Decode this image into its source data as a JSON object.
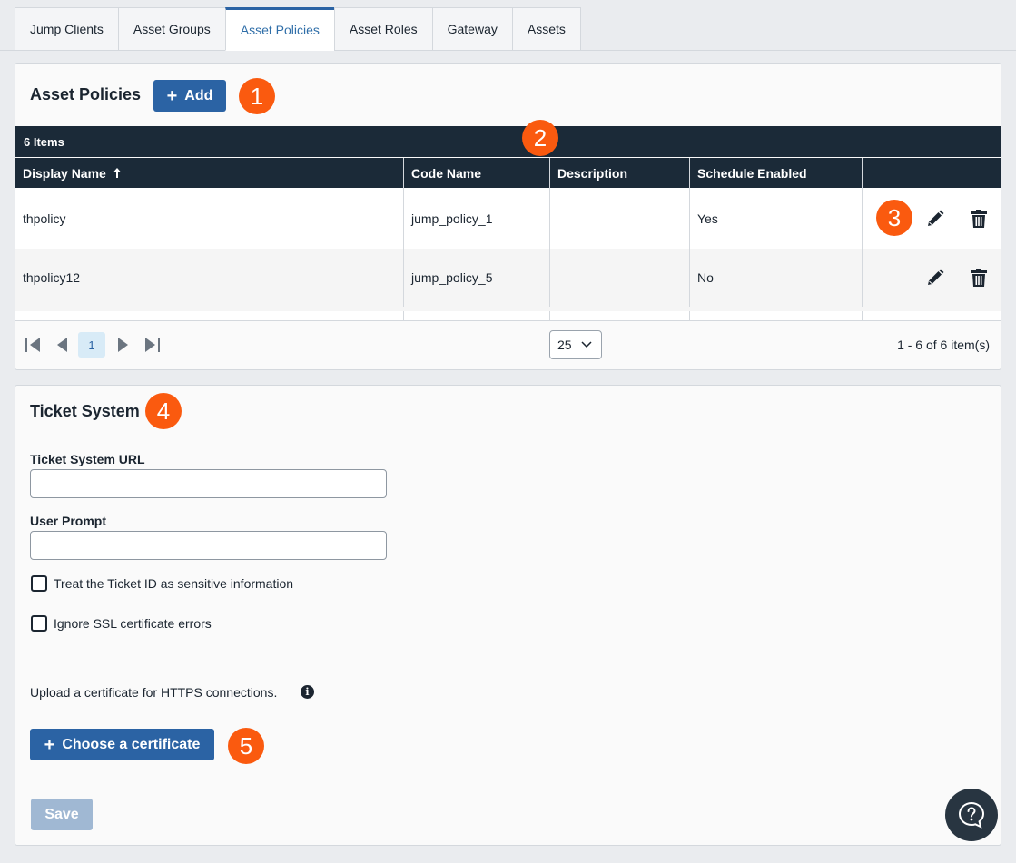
{
  "tabs": [
    {
      "label": "Jump Clients",
      "active": false
    },
    {
      "label": "Asset Groups",
      "active": false
    },
    {
      "label": "Asset Policies",
      "active": true
    },
    {
      "label": "Asset Roles",
      "active": false
    },
    {
      "label": "Gateway",
      "active": false
    },
    {
      "label": "Assets",
      "active": false
    }
  ],
  "policies": {
    "title": "Asset Policies",
    "add_label": "Add",
    "count_label": "6 Items",
    "columns": [
      "Display Name",
      "Code Name",
      "Description",
      "Schedule Enabled"
    ],
    "sort_icon": "arrow-up-icon",
    "rows": [
      {
        "display_name": "thpolicy",
        "code_name": "jump_policy_1",
        "description": "",
        "schedule_enabled": "Yes"
      },
      {
        "display_name": "thpolicy12",
        "code_name": "jump_policy_5",
        "description": "",
        "schedule_enabled": "No"
      }
    ],
    "pager": {
      "page": "1",
      "page_size": "25",
      "summary": "1 - 6 of 6 item(s)"
    }
  },
  "ticket": {
    "title": "Ticket System",
    "url_label": "Ticket System URL",
    "url_value": "",
    "prompt_label": "User Prompt",
    "prompt_value": "",
    "sensitive_label": "Treat the Ticket ID as sensitive information",
    "ssl_label": "Ignore SSL certificate errors",
    "upload_text": "Upload a certificate for HTTPS connections.",
    "choose_label": "Choose a certificate",
    "save_label": "Save"
  },
  "callouts": [
    "1",
    "2",
    "3",
    "4",
    "5"
  ],
  "colors": {
    "primary": "#2b63a4",
    "callout": "#fa5a0f",
    "header": "#1b2a38",
    "save_disabled": "#a0b8d3"
  }
}
